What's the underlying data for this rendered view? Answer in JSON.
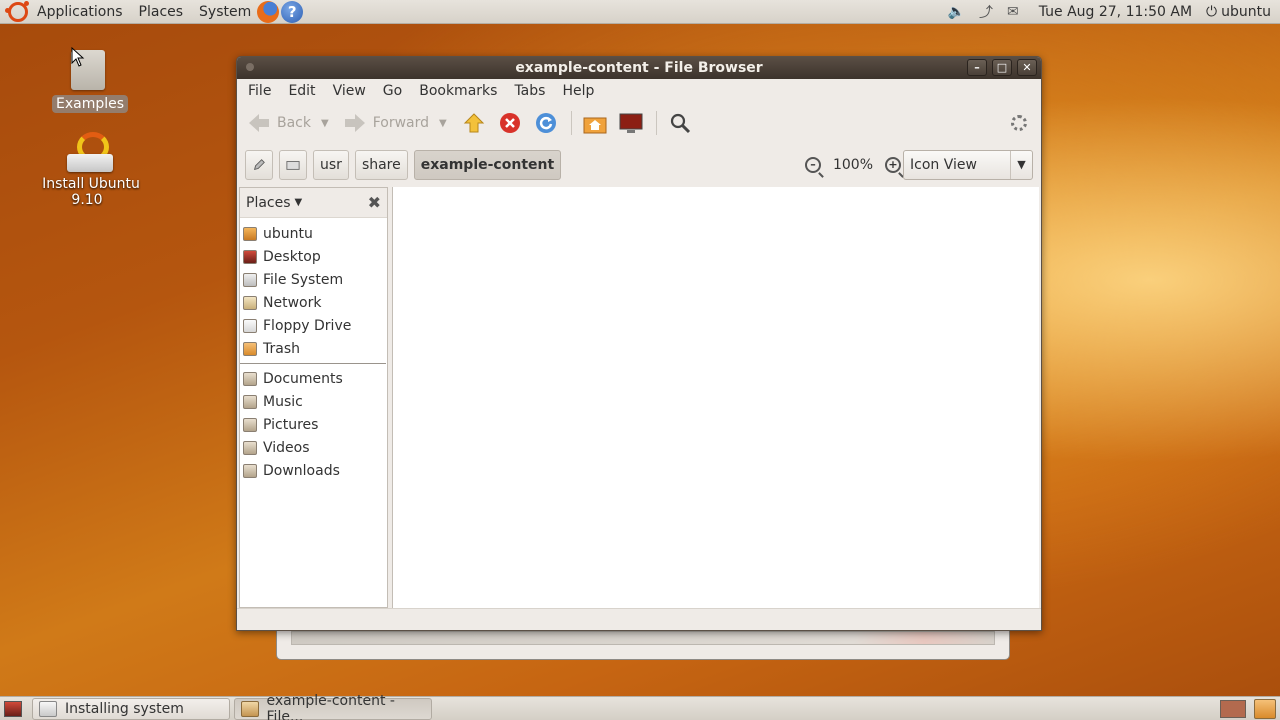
{
  "top_panel": {
    "menus": [
      "Applications",
      "Places",
      "System"
    ],
    "clock": "Tue Aug 27, 11:50 AM",
    "user": "ubuntu"
  },
  "desktop": {
    "icons": [
      {
        "label": "Examples"
      },
      {
        "label": "Install Ubuntu 9.10"
      }
    ]
  },
  "window": {
    "title": "example-content - File Browser",
    "menu": [
      "File",
      "Edit",
      "View",
      "Go",
      "Bookmarks",
      "Tabs",
      "Help"
    ],
    "toolbar": {
      "back_label": "Back",
      "forward_label": "Forward"
    },
    "location": {
      "crumbs": [
        "usr",
        "share",
        "example-content"
      ],
      "zoom": "100%",
      "view_mode": "Icon View"
    },
    "sidebar": {
      "header": "Places",
      "places": [
        {
          "label": "ubuntu",
          "icon": "home-folder-icon"
        },
        {
          "label": "Desktop",
          "icon": "desktop-icon"
        },
        {
          "label": "File System",
          "icon": "filesystem-icon"
        },
        {
          "label": "Network",
          "icon": "network-icon"
        },
        {
          "label": "Floppy Drive",
          "icon": "floppy-icon"
        },
        {
          "label": "Trash",
          "icon": "trash-icon"
        }
      ],
      "bookmarks": [
        {
          "label": "Documents",
          "icon": "documents-folder-icon"
        },
        {
          "label": "Music",
          "icon": "music-folder-icon"
        },
        {
          "label": "Pictures",
          "icon": "pictures-folder-icon"
        },
        {
          "label": "Videos",
          "icon": "videos-folder-icon"
        },
        {
          "label": "Downloads",
          "icon": "downloads-folder-icon"
        }
      ]
    }
  },
  "bottom_panel": {
    "tasks": [
      "Installing system",
      "example-content - File..."
    ]
  }
}
